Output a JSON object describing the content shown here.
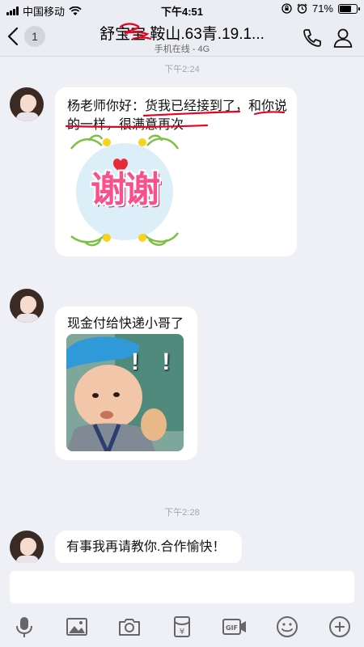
{
  "status_bar": {
    "carrier": "中国移动",
    "time": "下午4:51",
    "battery_percent": "71%",
    "battery_level": 0.71,
    "icons": [
      "signal-icon",
      "wifi-icon",
      "orientation-lock-icon",
      "alarm-icon",
      "battery-icon"
    ]
  },
  "nav": {
    "back_icon": "chevron-left-icon",
    "unread_count": "1",
    "title": "舒宝宝.鞍山.63青.19.1...",
    "subtitle": "手机在线 - 4G",
    "phone_icon": "phone-icon",
    "profile_icon": "person-icon"
  },
  "messages": [
    {
      "timestamp": "下午2:24",
      "text": "杨老师你好：货我已经接到了，和你说的一样，很满意再次",
      "sticker": {
        "text": "谢谢",
        "icon": "thanks-sticker"
      }
    },
    {
      "text": "现金付给快递小哥了",
      "sticker": {
        "text": "! !",
        "icon": "surprised-baby-sticker"
      }
    },
    {
      "timestamp": "下午2:28",
      "text": "有事我再请教你.合作愉快！"
    }
  ],
  "input": {
    "value": "",
    "placeholder": ""
  },
  "toolbar": {
    "icons": [
      "microphone-icon",
      "image-icon",
      "camera-icon",
      "red-packet-icon",
      "gif-icon",
      "emoji-icon",
      "plus-icon"
    ]
  },
  "colors": {
    "background": "#eef0f5",
    "bubble": "#ffffff",
    "annotation_red": "#e8001c",
    "timestamp": "#a4a6ab"
  }
}
